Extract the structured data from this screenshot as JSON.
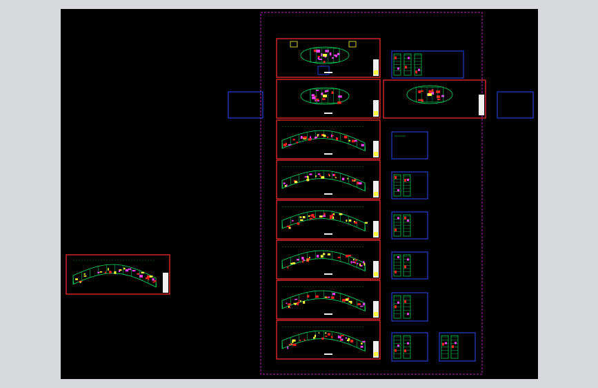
{
  "window": {
    "title": ""
  },
  "canvas": {
    "background": "#000000",
    "frame_color": "#d7d9dd"
  },
  "colors": {
    "sheet_border": "#ff2d2d",
    "viewport_border": "#2d4bff",
    "layout_border": "#c020c0",
    "wall": "#00e060",
    "furniture": "#ff2020",
    "fixture": "#ffff40",
    "accent_magenta": "#ff40ff",
    "title_block": "#f0f0f0"
  },
  "drawing": {
    "sheets_left_column": [
      {
        "name": "sheet-plan-level-1",
        "shape": "oval"
      },
      {
        "name": "sheet-plan-level-2",
        "shape": "oval"
      },
      {
        "name": "sheet-plan-level-3",
        "shape": "curved"
      },
      {
        "name": "sheet-plan-level-4",
        "shape": "curved"
      },
      {
        "name": "sheet-plan-level-5",
        "shape": "curved"
      },
      {
        "name": "sheet-plan-level-6",
        "shape": "curved"
      },
      {
        "name": "sheet-plan-level-7",
        "shape": "curved"
      },
      {
        "name": "sheet-plan-level-8",
        "shape": "curved"
      }
    ],
    "detail_sheets": [
      {
        "name": "detail-sheet-1",
        "content": "stairs"
      },
      {
        "name": "detail-sheet-3",
        "content": "empty"
      },
      {
        "name": "detail-sheet-4",
        "content": "stairs"
      },
      {
        "name": "detail-sheet-5",
        "content": "stairs"
      },
      {
        "name": "detail-sheet-6",
        "content": "stairs"
      },
      {
        "name": "detail-sheet-7",
        "content": "stairs"
      },
      {
        "name": "detail-sheet-8a",
        "content": "stairs"
      },
      {
        "name": "detail-sheet-8b",
        "content": "stairs"
      }
    ]
  }
}
